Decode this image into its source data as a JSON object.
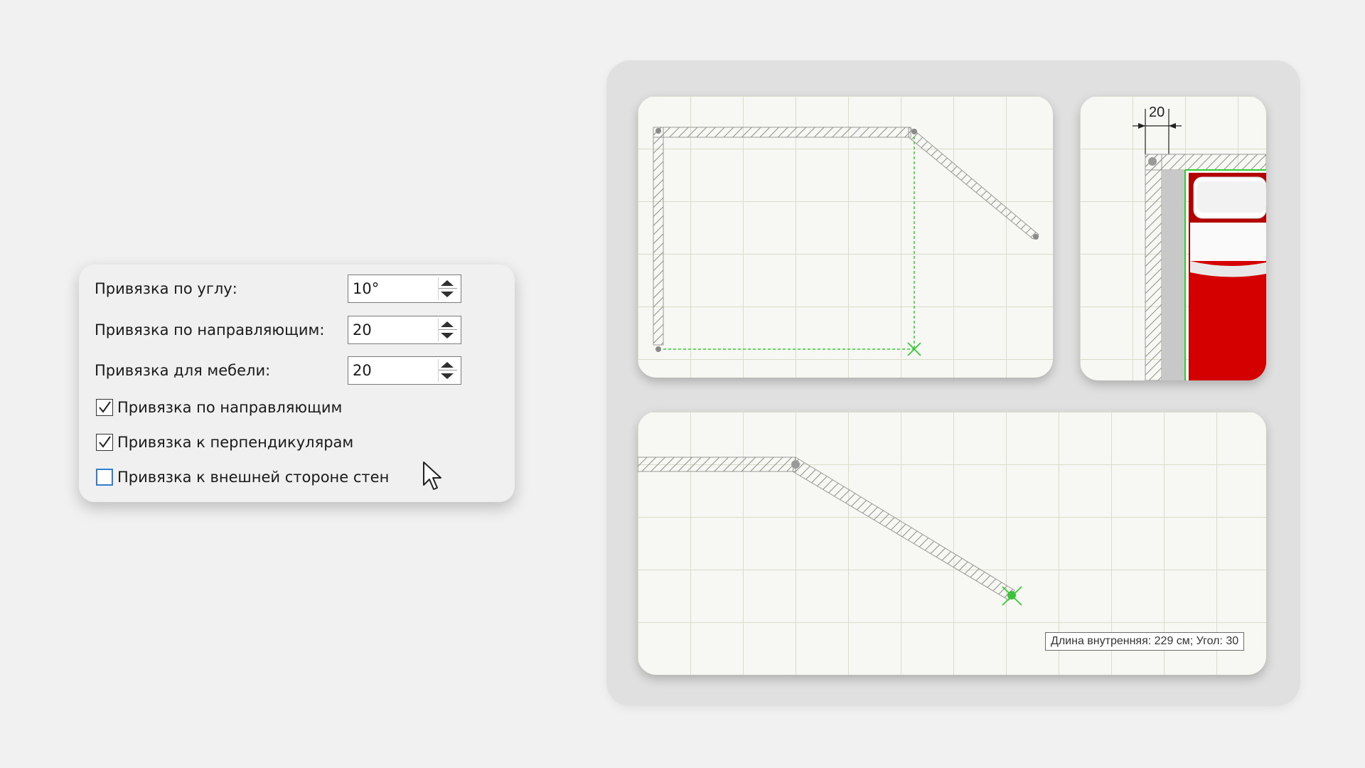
{
  "settings": {
    "angle_snap": {
      "label": "Привязка по углу:",
      "value": "10°"
    },
    "guide_snap": {
      "label": "Привязка по направляющим:",
      "value": "20"
    },
    "furniture_snap": {
      "label": "Привязка для мебели:",
      "value": "20"
    },
    "checkboxes": [
      {
        "label": "Привязка по направляющим",
        "checked": true
      },
      {
        "label": "Привязка к перпендикулярам",
        "checked": true
      },
      {
        "label": "Привязка к внешней стороне стен",
        "checked": false
      }
    ]
  },
  "top_right_pane": {
    "dimension_label": "20"
  },
  "bottom_pane": {
    "tooltip": "Длина внутренняя: 229 см; Угол: 30"
  },
  "colors": {
    "wall_hatch": "#8c8c8c",
    "guide_green": "#33cc33",
    "bed_red": "#d40000",
    "grid": "#d8dcc8"
  },
  "icons": [
    "spin-up-icon",
    "spin-down-icon",
    "checkmark-icon",
    "mouse-pointer-icon",
    "snap-cross-icon"
  ]
}
